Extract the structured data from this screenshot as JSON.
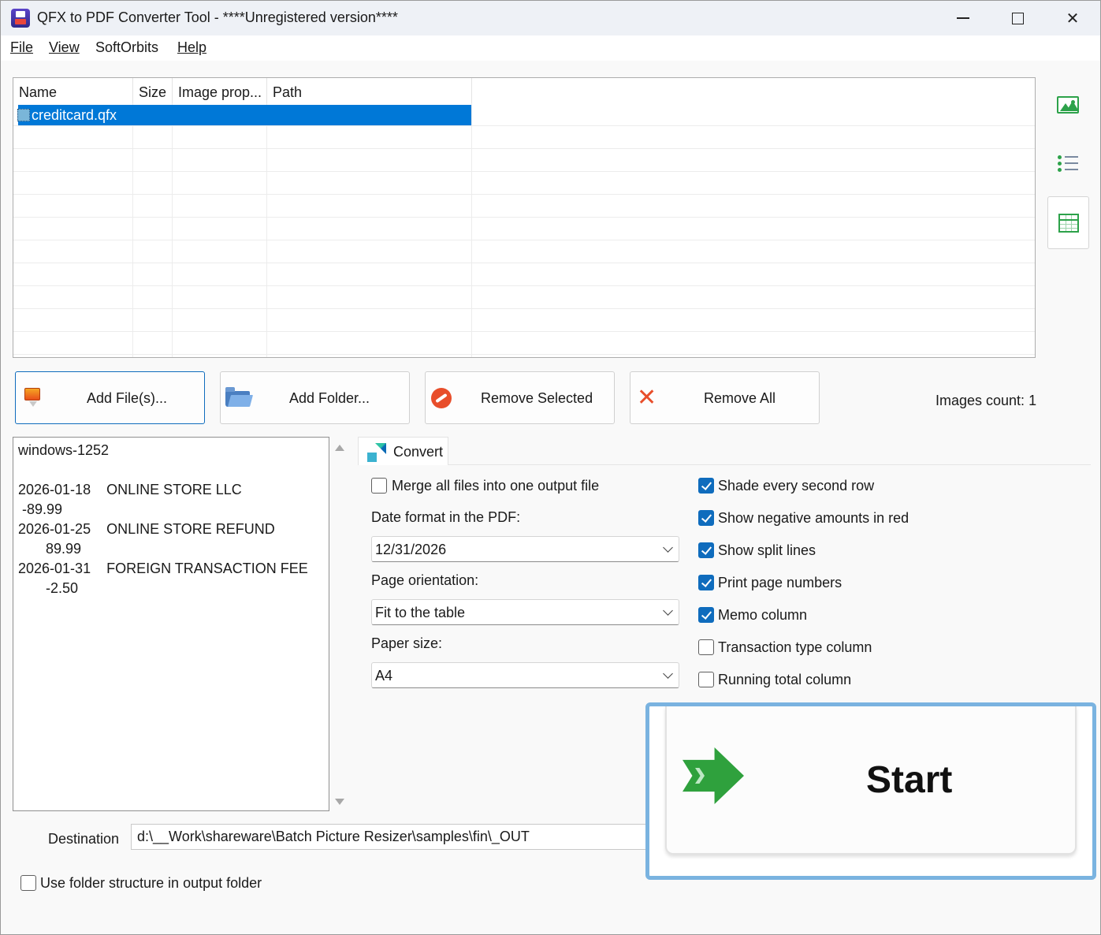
{
  "window": {
    "title": "QFX to PDF Converter Tool - ****Unregistered version****",
    "controls": {
      "minimize": "minimize",
      "maximize": "maximize",
      "close": "✕"
    }
  },
  "menu": {
    "items": [
      {
        "label": "File"
      },
      {
        "label": "View"
      },
      {
        "label": "SoftOrbits"
      },
      {
        "label": "Help"
      }
    ]
  },
  "file_list": {
    "columns": [
      "Name",
      "Size",
      "Image prop...",
      "Path"
    ],
    "rows": [
      {
        "name": "creditcard.qfx",
        "size": "",
        "image_prop": "",
        "path": "",
        "selected": true
      }
    ]
  },
  "side_toolbar": {
    "icons": [
      "image-view-icon",
      "list-view-icon",
      "table-view-icon"
    ],
    "active": "table-view-icon"
  },
  "actions": {
    "add_files": "Add File(s)...",
    "add_folder": "Add Folder...",
    "remove_selected": "Remove Selected",
    "remove_all": "Remove All",
    "images_count": "Images count: 1"
  },
  "preview": {
    "lines": [
      "windows-1252",
      "",
      "2026-01-18    ONLINE STORE LLC",
      " -89.99",
      "2026-01-25    ONLINE STORE REFUND",
      "       89.99",
      "2026-01-31    FOREIGN TRANSACTION FEE",
      "       -2.50"
    ]
  },
  "convert_tab": {
    "tab_label": "Convert",
    "merge_label": "Merge all files into one output file",
    "merge_checked": false,
    "date_format_label": "Date format in the PDF:",
    "date_format_value": "12/31/2026",
    "orientation_label": "Page orientation:",
    "orientation_value": "Fit to the table",
    "paper_size_label": "Paper size:",
    "paper_size_value": "A4",
    "options": [
      {
        "label": "Shade every second row",
        "checked": true
      },
      {
        "label": "Show negative amounts in red",
        "checked": true
      },
      {
        "label": "Show split lines",
        "checked": true
      },
      {
        "label": "Print page numbers",
        "checked": true
      },
      {
        "label": "Memo column",
        "checked": true
      },
      {
        "label": "Transaction type column",
        "checked": false
      },
      {
        "label": "Running total column",
        "checked": false
      }
    ]
  },
  "destination": {
    "label": "Destination",
    "value": "d:\\__Work\\shareware\\Batch Picture Resizer\\samples\\fin\\_OUT",
    "use_folder_structure_label": "Use folder structure in output folder",
    "use_folder_structure_checked": false
  },
  "start": {
    "label": "Start"
  },
  "colors": {
    "accent": "#0078d7",
    "checkbox_on": "#0f6cbd",
    "icon_green": "#2da24a",
    "remove_red": "#e84e2b",
    "highlight_frame": "#7ab3e0"
  }
}
